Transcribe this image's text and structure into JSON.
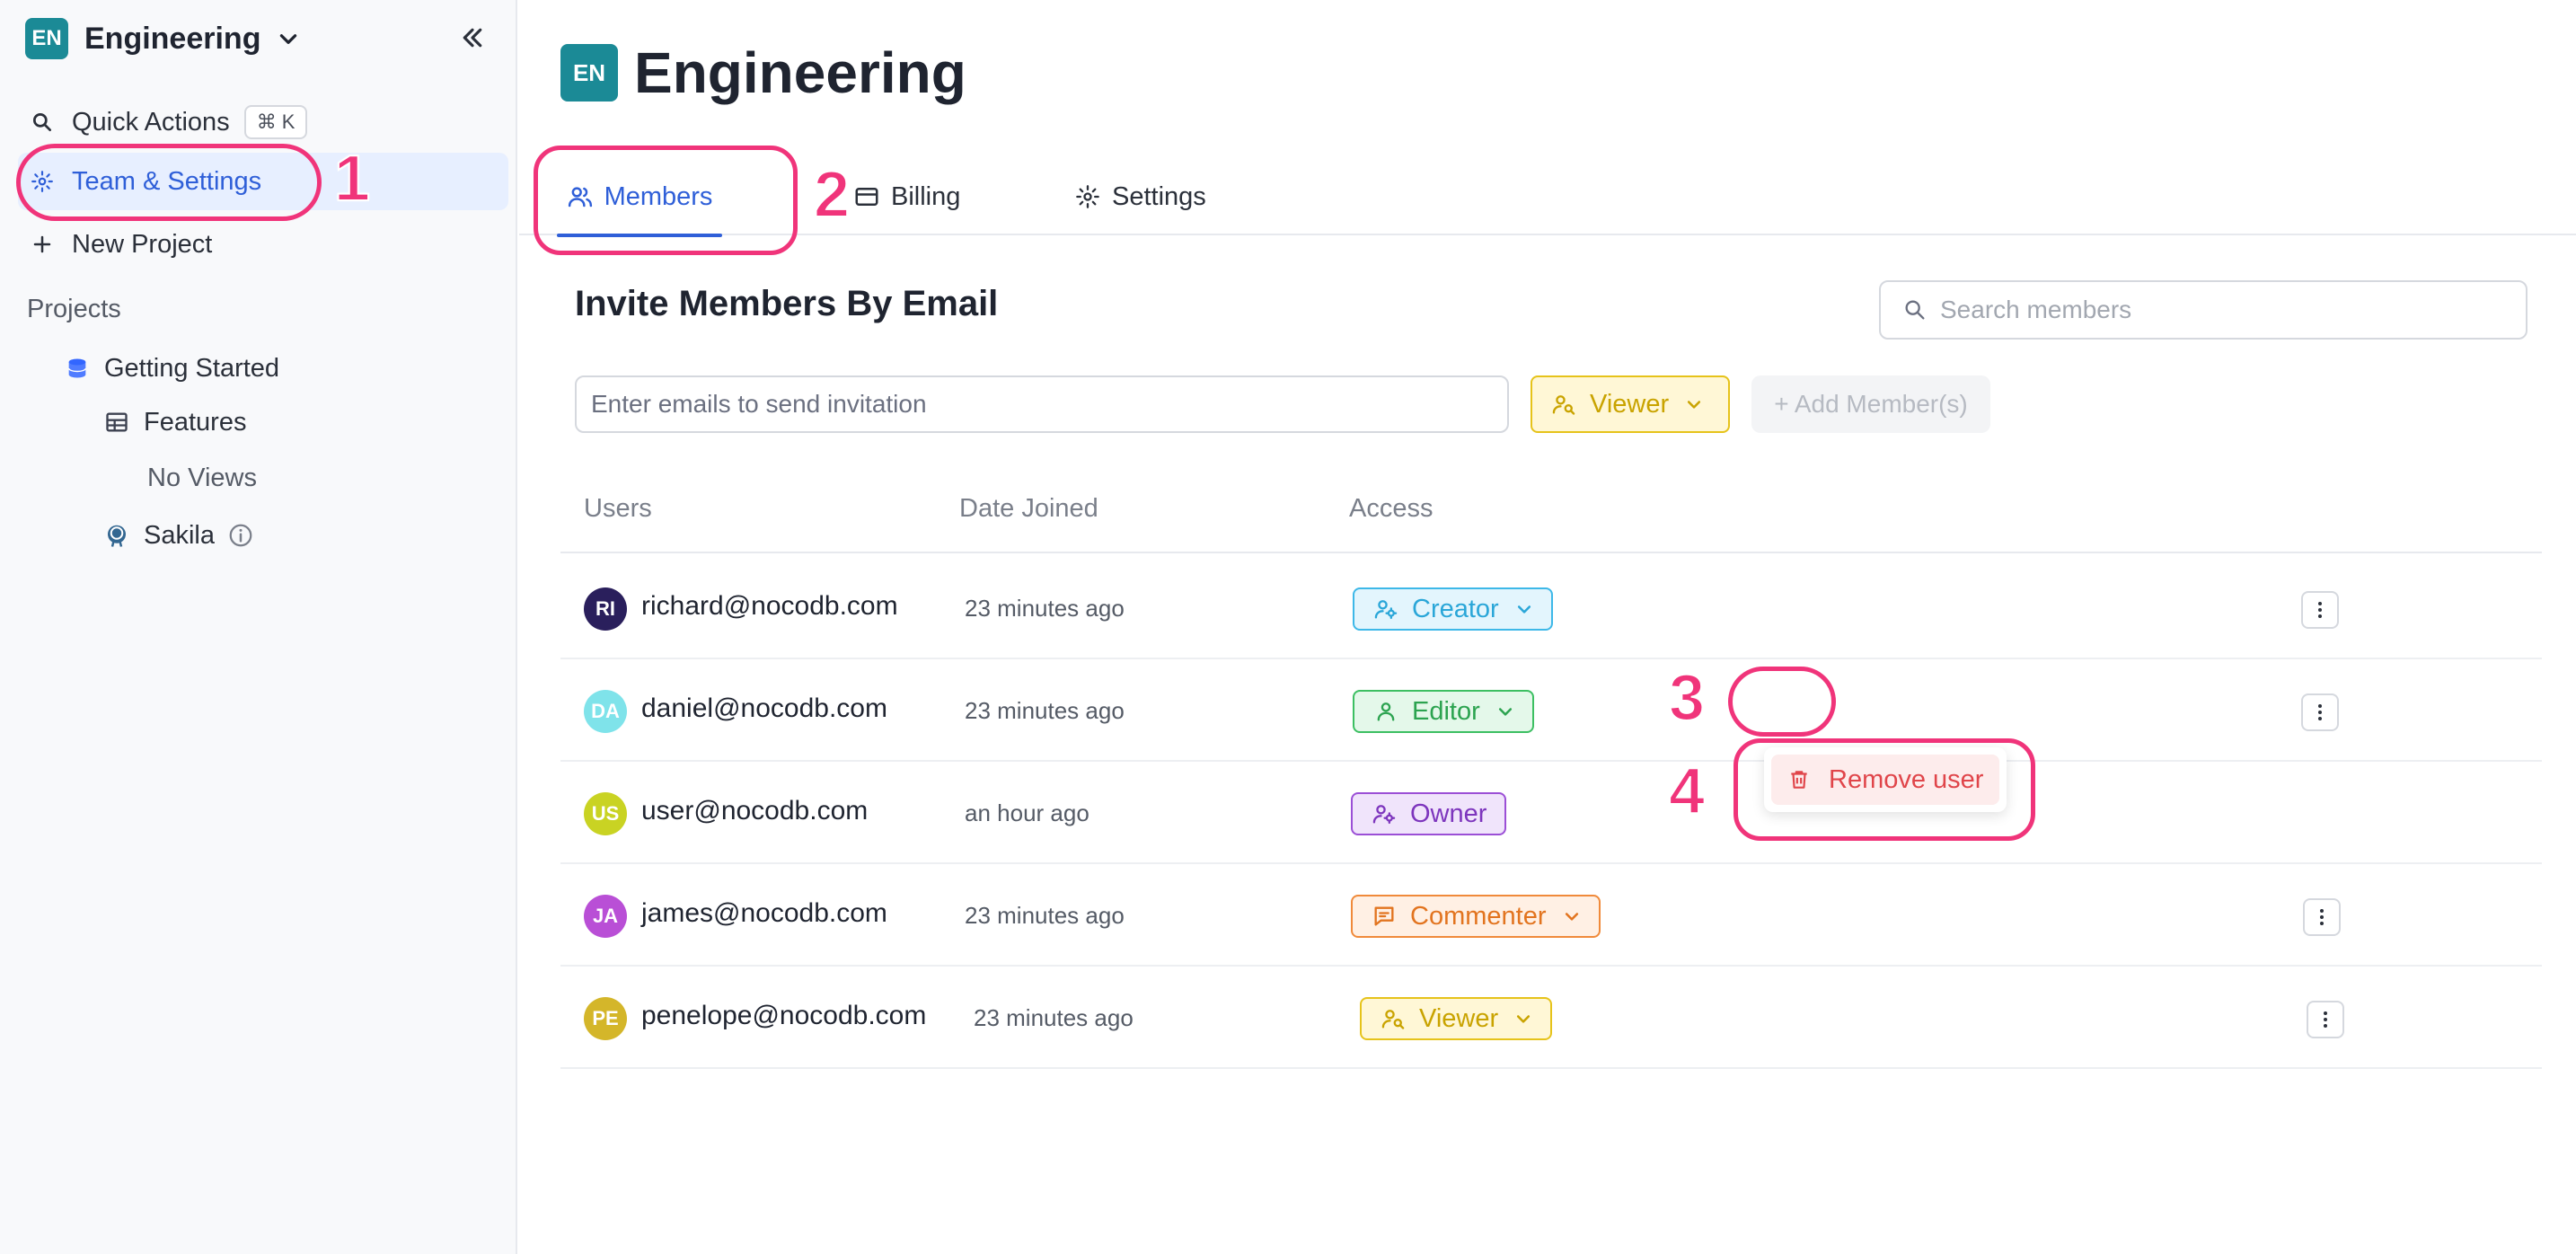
{
  "sidebar": {
    "workspace_badge": "EN",
    "workspace_name": "Engineering",
    "quick_actions": "Quick Actions",
    "quick_actions_shortcut": "⌘ K",
    "team_settings": "Team & Settings",
    "new_project": "New Project",
    "projects_label": "Projects",
    "tree": {
      "getting_started": "Getting Started",
      "features": "Features",
      "no_views": "No Views",
      "sakila": "Sakila"
    }
  },
  "header": {
    "badge": "EN",
    "title": "Engineering"
  },
  "tabs": {
    "members": "Members",
    "billing": "Billing",
    "settings": "Settings"
  },
  "invite": {
    "title": "Invite Members By Email",
    "email_placeholder": "Enter emails to send invitation",
    "role": "Viewer",
    "add_button": "+ Add Member(s)"
  },
  "search": {
    "placeholder": "Search members"
  },
  "table": {
    "headers": {
      "users": "Users",
      "date_joined": "Date Joined",
      "access": "Access"
    },
    "rows": [
      {
        "initials": "RI",
        "email": "richard@nocodb.com",
        "date": "23 minutes ago",
        "role": "Creator",
        "avatar_color": "#2a1f5c"
      },
      {
        "initials": "DA",
        "email": "daniel@nocodb.com",
        "date": "23 minutes ago",
        "role": "Editor",
        "avatar_color": "#7fe3ea"
      },
      {
        "initials": "US",
        "email": "user@nocodb.com",
        "date": "an hour ago",
        "role": "Owner",
        "avatar_color": "#c9d323"
      },
      {
        "initials": "JA",
        "email": "james@nocodb.com",
        "date": "23 minutes ago",
        "role": "Commenter",
        "avatar_color": "#b94fd6"
      },
      {
        "initials": "PE",
        "email": "penelope@nocodb.com",
        "date": "23 minutes ago",
        "role": "Viewer",
        "avatar_color": "#d4b62a"
      }
    ]
  },
  "menu": {
    "remove_user": "Remove user"
  },
  "annotations": [
    "1",
    "2",
    "3",
    "4"
  ],
  "colors": {
    "accent": "#2f5fd8",
    "brand": "#1b8a96",
    "annotation": "#f0347a",
    "danger": "#e0454a"
  }
}
